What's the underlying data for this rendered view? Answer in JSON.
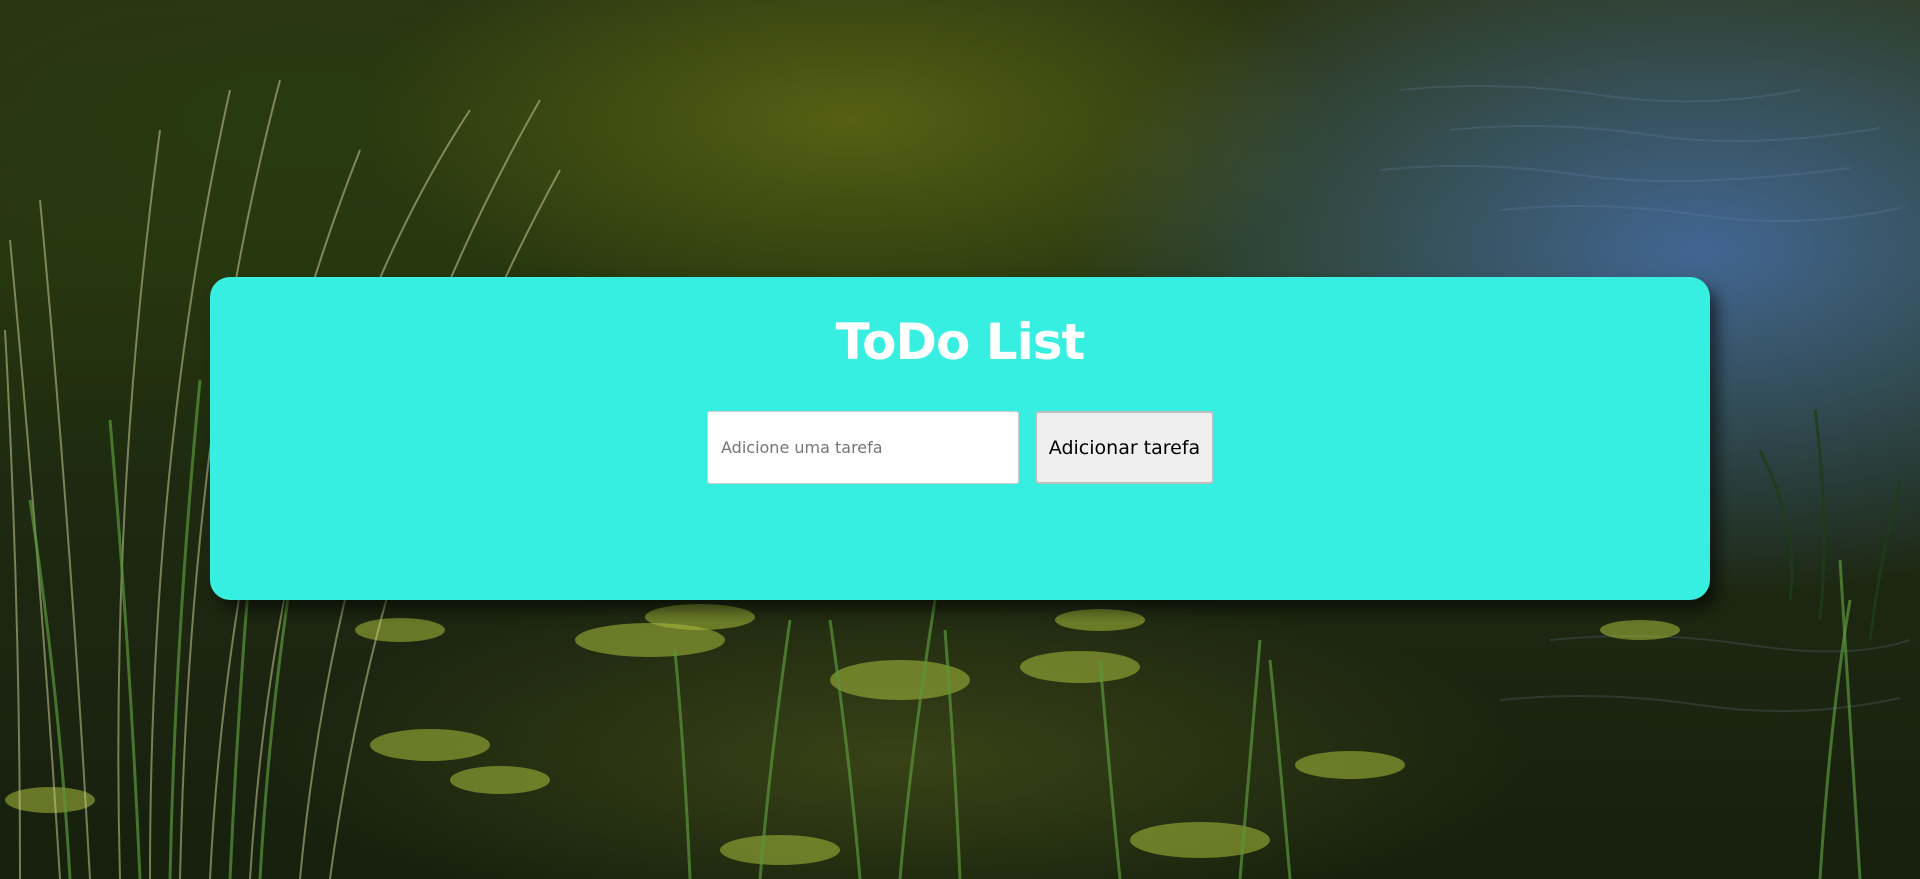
{
  "app": {
    "title": "ToDo List"
  },
  "add_task": {
    "input_value": "",
    "input_placeholder": "Adicione uma tarefa",
    "button_label": "Adicionar tarefa"
  },
  "tasks": [],
  "colors": {
    "card_background": "#36efe0",
    "title_text": "#ffffff",
    "button_background": "#efefef"
  },
  "background": {
    "scene": "pond-with-reeds-and-lily-pads"
  }
}
